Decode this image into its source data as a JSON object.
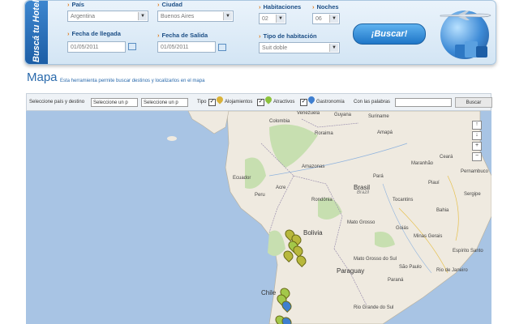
{
  "form": {
    "tab_title": "Buscá tu Hotel",
    "pais": {
      "label": "País",
      "value": "Argentina"
    },
    "ciudad": {
      "label": "Ciudad",
      "value": "Buenos Aires"
    },
    "habitaciones": {
      "label": "Habitaciones",
      "value": "02"
    },
    "noches": {
      "label": "Noches",
      "value": "06"
    },
    "llegada": {
      "label": "Fecha de llegada",
      "value": "01/05/2011"
    },
    "salida": {
      "label": "Fecha de Salida",
      "value": "01/05/2011"
    },
    "tipo": {
      "label": "Tipo de habitación",
      "value": "Suit doble"
    },
    "search_button": "¡Buscar!"
  },
  "map_section": {
    "title": "Mapa",
    "description": "Esta herramienta permite buscar destinos y localizarlos en el mapa",
    "filter": {
      "select_label": "Seleccione país y destino",
      "select1": "Seleccione un p",
      "select2": "Seleccione un p",
      "tipo_label": "Tipo",
      "alojamientos": "Alojamientos",
      "atractivos": "Atractivos",
      "gastronomia": "Gastronomía",
      "keywords_label": "Con las palabras",
      "search_button": "Buscar"
    },
    "zoom": {
      "up": "↑",
      "down": "↓",
      "plus": "+",
      "minus": "−"
    },
    "labels": {
      "guyana": "Guyana",
      "suriname": "Suriname",
      "colombia": "Colombia",
      "venezuela": "Venezuela",
      "ecuador": "Ecuador",
      "peru": "Peru",
      "brasil": "Brasil",
      "brasil_it": "Brazil",
      "bolivia": "Bolivia",
      "paraguay": "Paraguay",
      "chile": "Chile",
      "amapa": "Amapá",
      "para": "Pará",
      "amazonas": "Amazonas",
      "roraima": "Roraima",
      "acre": "Acre",
      "rondonia": "Rondônia",
      "tocantins": "Tocantins",
      "bahia": "Bahia",
      "goias": "Goiás",
      "mato_grosso": "Mato Grosso",
      "ms": "Mato Grosso do Sul",
      "sao_paulo": "São Paulo",
      "minas": "Minas Gerais",
      "parana": "Paraná",
      "rio_grande": "Rio Grande do Sul",
      "espirito": "Espírito Santo",
      "rio": "Rio de Janeiro",
      "maranhao": "Maranhão",
      "piaui": "Piauí",
      "ceara": "Ceará",
      "pernambuco": "Pernambuco",
      "sergipe": "Sergipe"
    }
  },
  "colors": {
    "land": "#efeae0",
    "water": "#a8c4e4",
    "forest": "#c7dfb0",
    "marker": "#b8b83c"
  }
}
